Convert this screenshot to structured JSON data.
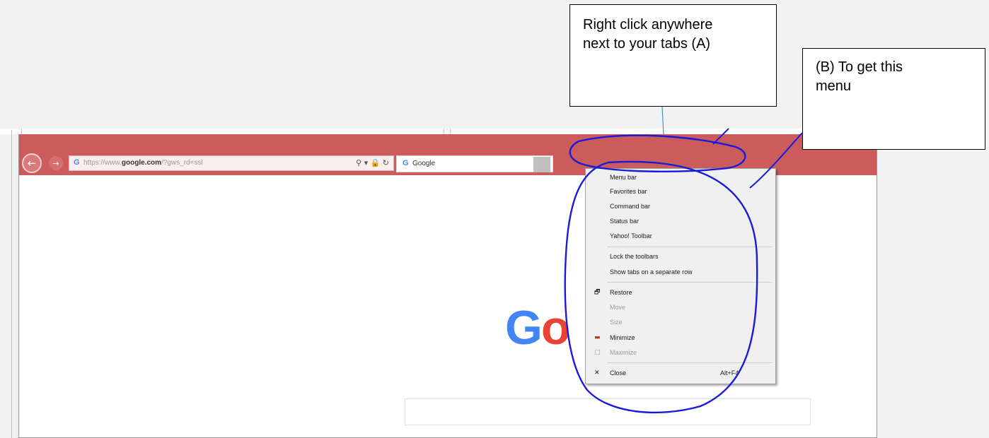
{
  "browser": {
    "address_g": "G",
    "address_url_scheme": "https://www.",
    "address_url_host": "google.com",
    "address_url_path": "/?gws_rd=ssl",
    "address_icons": "⚲ ▾ 🔒 ↻",
    "tab_g": "G",
    "tab_title": "Google",
    "tab_close": "×",
    "back_icon": "←",
    "forward_icon": "→"
  },
  "page": {
    "logo_part1": "G",
    "logo_part2": "o"
  },
  "context_menu": {
    "items": [
      {
        "label": "Menu bar"
      },
      {
        "label": "Favorites bar"
      },
      {
        "label": "Command bar"
      },
      {
        "label": "Status bar"
      },
      {
        "label": "Yahoo! Toolbar"
      },
      {
        "label": "Lock the toolbars"
      },
      {
        "label": "Show tabs on a separate row"
      },
      {
        "label": "Restore",
        "icon": "restore-icon"
      },
      {
        "label": "Move",
        "disabled": true
      },
      {
        "label": "Size",
        "disabled": true
      },
      {
        "label": "Minimize",
        "icon": "minimize-icon"
      },
      {
        "label": "Maximize",
        "icon": "maximize-icon",
        "disabled": true
      },
      {
        "label": "Close",
        "icon": "close-icon",
        "shortcut": "Alt+F4"
      }
    ]
  },
  "callouts": {
    "a_line1": "Right click anywhere",
    "a_line2": "next to your tabs (A)",
    "b_line1": "(B) To get this",
    "b_line2": "menu"
  },
  "colors": {
    "titlebar": "#cc5c5c",
    "annotation_ink": "#1a1adb",
    "connector_line": "#4a90c8"
  }
}
